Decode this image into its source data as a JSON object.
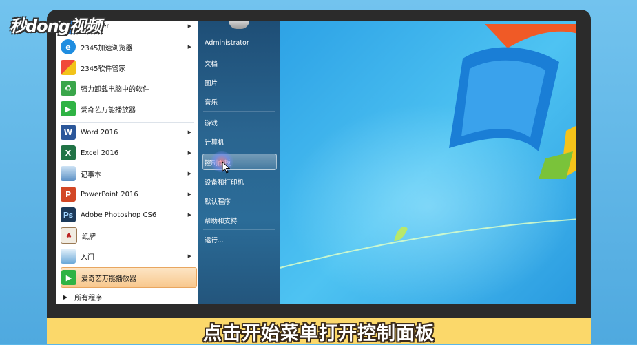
{
  "watermark": "秒dong视频",
  "caption": "点击开始菜单打开控制面板",
  "start_menu": {
    "programs": [
      {
        "label": "Explorer",
        "icon": "ie-icon",
        "color": "#2f7fd6",
        "arrow": true
      },
      {
        "label": "2345加速浏览器",
        "icon": "browser-2345-icon",
        "color": "#1f8de0",
        "arrow": true
      },
      {
        "label": "2345软件管家",
        "icon": "software-manager-icon",
        "color": "#f2a51a",
        "arrow": false
      },
      {
        "label": "强力卸载电脑中的软件",
        "icon": "recycle-bin-icon",
        "color": "#3aa64a",
        "arrow": false
      },
      {
        "label": "爱奇艺万能播放器",
        "icon": "iqiyi-icon",
        "color": "#2fb344",
        "arrow": false
      },
      {
        "label": "Word 2016",
        "icon": "word-icon",
        "color": "#2b579a",
        "arrow": true
      },
      {
        "label": "Excel 2016",
        "icon": "excel-icon",
        "color": "#217346",
        "arrow": true
      },
      {
        "label": "记事本",
        "icon": "notepad-icon",
        "color": "#5a8fc4",
        "arrow": true
      },
      {
        "label": "PowerPoint 2016",
        "icon": "powerpoint-icon",
        "color": "#d24726",
        "arrow": true
      },
      {
        "label": "Adobe Photoshop CS6",
        "icon": "photoshop-icon",
        "color": "#1c3a5a",
        "arrow": true
      },
      {
        "label": "纸牌",
        "icon": "solitaire-icon",
        "color": "#9a7a55",
        "arrow": false
      },
      {
        "label": "入门",
        "icon": "getting-started-icon",
        "color": "#6aa8d8",
        "arrow": true
      },
      {
        "label": "爱奇艺万能播放器",
        "icon": "iqiyi-icon",
        "color": "#2fb344",
        "arrow": false
      }
    ],
    "all_programs": "所有程序",
    "places": [
      "Administrator",
      "文档",
      "图片",
      "音乐",
      "游戏",
      "计算机",
      "控制面板",
      "设备和打印机",
      "默认程序",
      "帮助和支持",
      "运行..."
    ]
  }
}
